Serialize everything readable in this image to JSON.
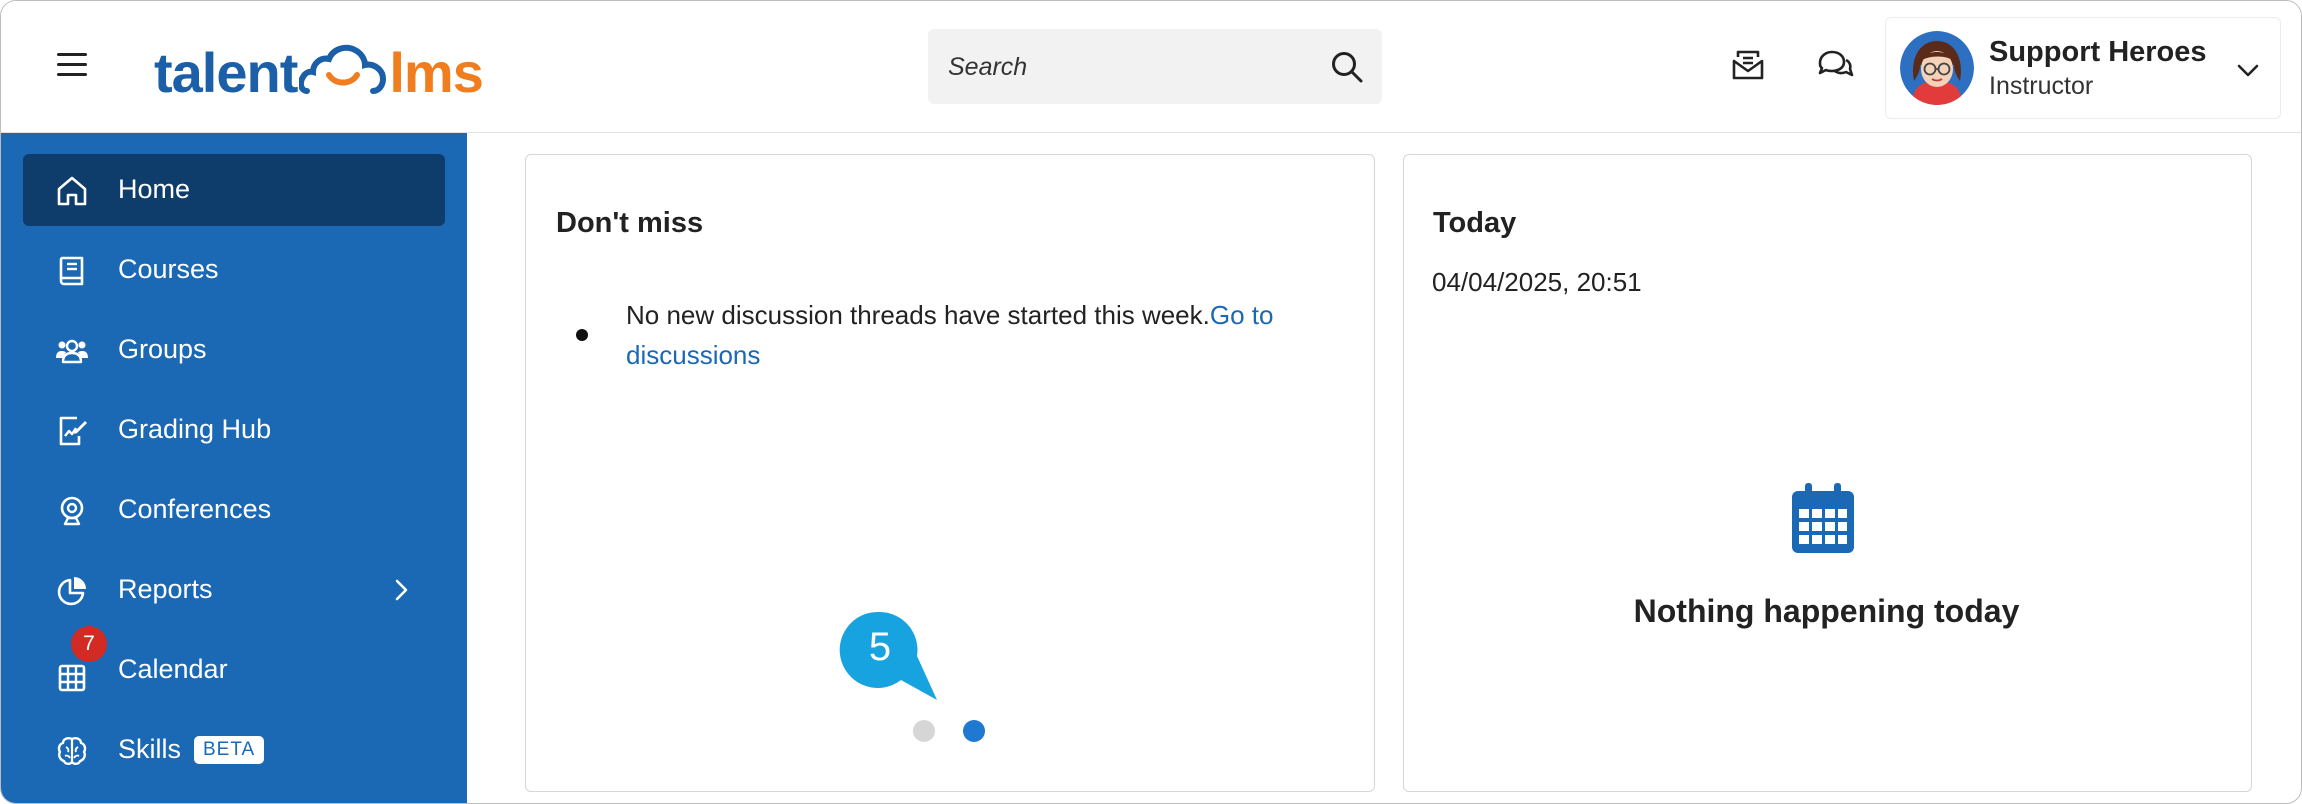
{
  "header": {
    "logo": {
      "part1": "talent",
      "part2": "lms"
    },
    "search": {
      "placeholder": "Search"
    },
    "icons": [
      "menu-icon",
      "search-icon",
      "inbox-icon",
      "chat-icon",
      "chevron-down-icon"
    ],
    "user": {
      "name": "Support Heroes",
      "role": "Instructor"
    }
  },
  "sidebar": {
    "items": [
      {
        "label": "Home",
        "icon": "home-icon",
        "active": true
      },
      {
        "label": "Courses",
        "icon": "book-icon"
      },
      {
        "label": "Groups",
        "icon": "users-icon"
      },
      {
        "label": "Grading Hub",
        "icon": "grading-icon"
      },
      {
        "label": "Conferences",
        "icon": "webcam-icon"
      },
      {
        "label": "Reports",
        "icon": "pie-chart-icon"
      },
      {
        "label": "Calendar",
        "icon": "calendar-grid-icon",
        "badge": "7"
      },
      {
        "label": "Skills",
        "icon": "brain-icon",
        "tag": "BETA"
      }
    ]
  },
  "dont_miss": {
    "title": "Don't miss",
    "message": "No new discussion threads have started this week.",
    "link": "Go to discussions",
    "step_marker": "5"
  },
  "today": {
    "title": "Today",
    "datetime": "04/04/2025, 20:51",
    "empty_text": "Nothing happening today"
  },
  "colors": {
    "brand_blue": "#1b68b4",
    "brand_orange": "#f07e1f",
    "active_nav": "#0f3d6b",
    "badge_red": "#d42a24",
    "step_marker": "#17a2e0"
  }
}
